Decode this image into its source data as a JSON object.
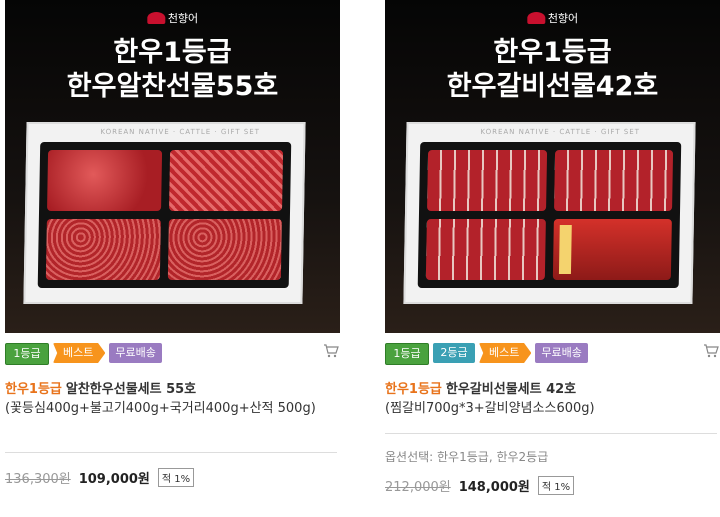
{
  "products": [
    {
      "logo": "천향어",
      "headline1": "한우1등급",
      "headline2": "한우알찬선물55호",
      "tray_label": "KOREAN NATIVE · CATTLE · GIFT SET",
      "badges": [
        "1등급",
        "베스트",
        "무료배송"
      ],
      "grade": "한우1등급",
      "name": "알찬한우선물세트 55호",
      "desc": "(꽃등심400g+불고기400g+국거리400g+산적 500g)",
      "option": "",
      "old_price": "136,300원",
      "price": "109,000원",
      "point": "적 1%"
    },
    {
      "logo": "천향어",
      "headline1": "한우1등급",
      "headline2": "한우갈비선물42호",
      "tray_label": "KOREAN NATIVE · CATTLE · GIFT SET",
      "badges": [
        "1등급",
        "2등급",
        "베스트",
        "무료배송"
      ],
      "grade": "한우1등급",
      "name": "한우갈비선물세트 42호",
      "desc": "(찜갈비700g*3+갈비양념소스600g)",
      "option": "옵션선택: 한우1등급, 한우2등급",
      "old_price": "212,000원",
      "price": "148,000원",
      "point": "적 1%"
    }
  ],
  "icons": {
    "cart": "cart-icon"
  },
  "colors": {
    "grade_green": "#4aa23e",
    "grade2_teal": "#3aa0b4",
    "best_orange": "#f7941d",
    "free_purple": "#9a7bc1",
    "grade_text": "#e8731b"
  }
}
